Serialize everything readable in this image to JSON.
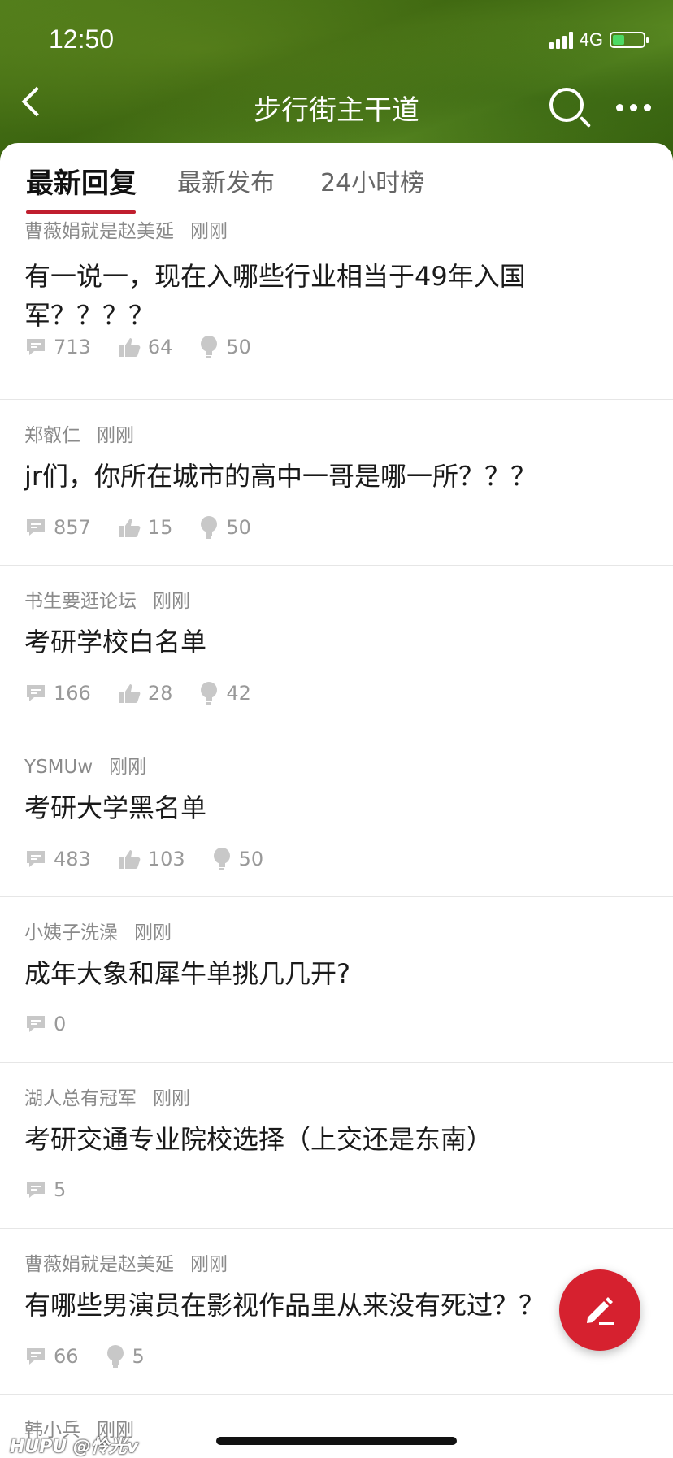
{
  "status_bar": {
    "time": "12:50",
    "network": "4G"
  },
  "header": {
    "title": "步行街主干道"
  },
  "tabs": [
    {
      "label": "最新回复"
    },
    {
      "label": "最新发布"
    },
    {
      "label": "24小时榜"
    }
  ],
  "posts": [
    {
      "author": "曹薇娟就是赵美延",
      "time": "刚刚",
      "title": "有一说一，现在入哪些行业相当于49年入国军？？？？",
      "replies": "713",
      "likes": "64",
      "lights": "50"
    },
    {
      "author": "郑叡仁",
      "time": "刚刚",
      "title": "jr们，你所在城市的高中一哥是哪一所？？？",
      "replies": "857",
      "likes": "15",
      "lights": "50"
    },
    {
      "author": "书生要逛论坛",
      "time": "刚刚",
      "title": "考研学校白名单",
      "replies": "166",
      "likes": "28",
      "lights": "42"
    },
    {
      "author": "YSMUw",
      "time": "刚刚",
      "title": "考研大学黑名单",
      "replies": "483",
      "likes": "103",
      "lights": "50"
    },
    {
      "author": "小姨子洗澡",
      "time": "刚刚",
      "title": "成年大象和犀牛单挑几几开?",
      "replies": "0"
    },
    {
      "author": "湖人总有冠军",
      "time": "刚刚",
      "title": "考研交通专业院校选择（上交还是东南）",
      "replies": "5"
    },
    {
      "author": "曹薇娟就是赵美延",
      "time": "刚刚",
      "title": "有哪些男演员在影视作品里从来没有死过？？",
      "replies": "66",
      "lights": "5"
    },
    {
      "author": "韩小兵",
      "time": "刚刚"
    }
  ],
  "watermark": "HUPU @怜光v",
  "colors": {
    "accent": "#d6212f",
    "tab_underline": "#c01e2e",
    "header_green": "#4f7a1a"
  },
  "icons": [
    "back-icon",
    "search-icon",
    "more-icon",
    "reply-icon",
    "like-icon",
    "light-icon",
    "edit-icon"
  ]
}
